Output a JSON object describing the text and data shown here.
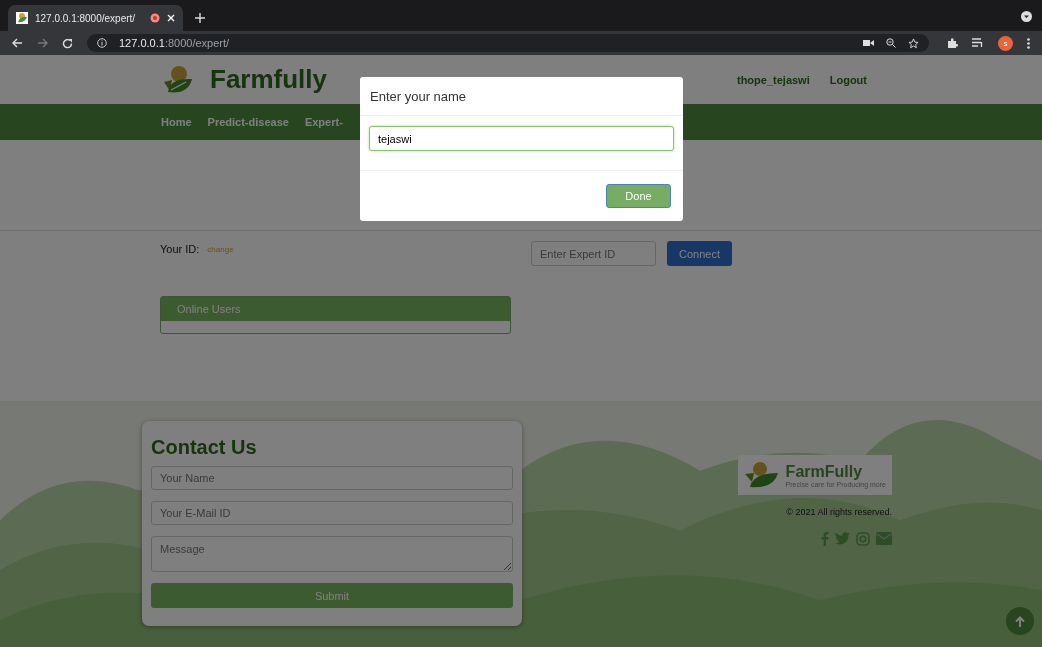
{
  "browser": {
    "tab_title": "127.0.0.1:8000/expert/",
    "url_host": "127.0.0.1",
    "url_path": ":8000/expert/",
    "profile_initial": "s"
  },
  "header": {
    "brand": "Farmfully",
    "user": "thope_tejaswi",
    "logout": "Logout"
  },
  "nav": [
    {
      "label": "Home"
    },
    {
      "label": "Predict-disease"
    },
    {
      "label": "Expert-"
    }
  ],
  "connect": {
    "id_label": "Your ID:",
    "change": "change",
    "expert_id_placeholder": "Enter Expert ID",
    "connect_button": "Connect"
  },
  "online_users": {
    "title": "Online Users"
  },
  "contact": {
    "title": "Contact Us",
    "name_placeholder": "Your Name",
    "email_placeholder": "Your E-Mail ID",
    "message_placeholder": "Message",
    "submit": "Submit"
  },
  "footer": {
    "logo_name": "FarmFully",
    "tagline": "Precise care for Producing more",
    "copyright": "© 2021 All rights reserved."
  },
  "modal": {
    "title": "Enter your name",
    "value": "tejaswi",
    "done": "Done"
  }
}
